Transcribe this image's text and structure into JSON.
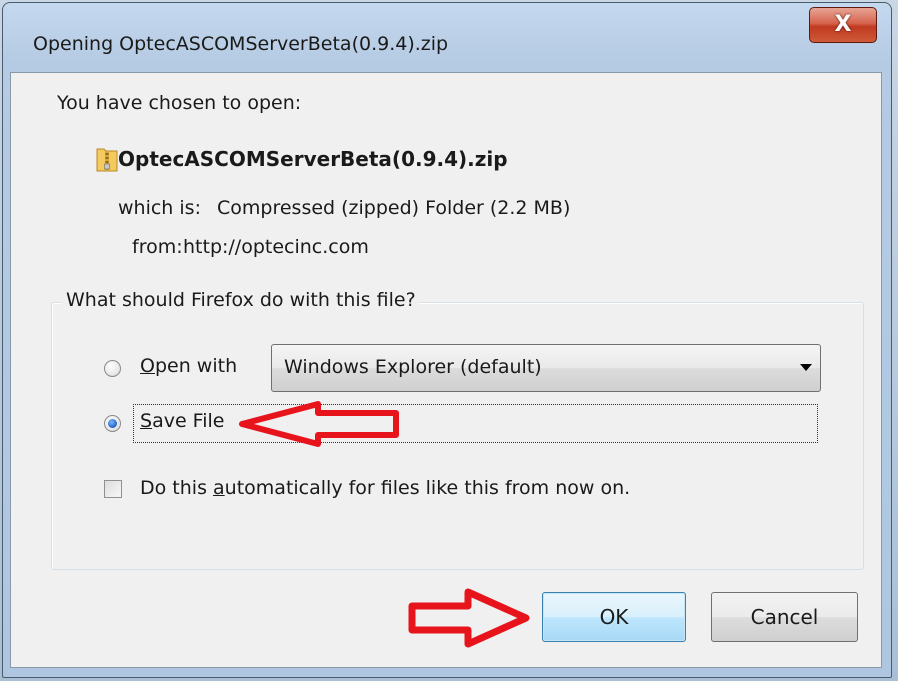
{
  "window": {
    "title": "Opening OptecASCOMServerBeta(0.9.4).zip",
    "close_glyph": "X"
  },
  "dialog": {
    "intro": "You have chosen to open:",
    "file_icon": "zip-folder-icon",
    "file_name": "OptecASCOMServerBeta(0.9.4).zip",
    "which_is_label": "which is:",
    "which_is_value": "Compressed (zipped) Folder (2.2 MB)",
    "from_label": "from:",
    "from_value": "http://optecinc.com"
  },
  "action_group": {
    "legend": "What should Firefox do with this file?",
    "open_with": {
      "mnemonic": "O",
      "label_rest": "pen with",
      "selected": false
    },
    "open_with_app": "Windows Explorer (default)",
    "save_file": {
      "mnemonic": "S",
      "label_rest": "ave File",
      "selected": true
    },
    "auto": {
      "label_before": "Do this ",
      "mnemonic": "a",
      "label_after": "utomatically for files like this from now on.",
      "checked": false
    }
  },
  "buttons": {
    "ok": "OK",
    "cancel": "Cancel"
  },
  "annotations": {
    "arrow_color": "#e8141c"
  }
}
